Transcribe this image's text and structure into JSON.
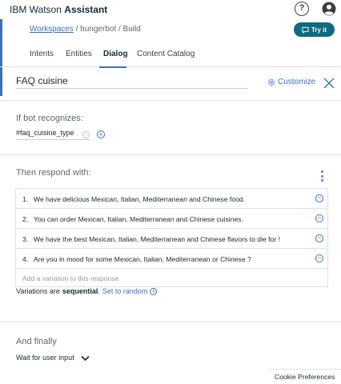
{
  "header": {
    "brand_prefix": "IBM Watson",
    "brand_name": "Assistant",
    "help_glyph": "?"
  },
  "breadcrumb": {
    "workspaces": "Workspaces",
    "path": " / hungerbot / Build"
  },
  "try_button": {
    "label": "Try it"
  },
  "tabs": [
    {
      "label": "Intents",
      "active": false
    },
    {
      "label": "Entities",
      "active": false
    },
    {
      "label": "Dialog",
      "active": true
    },
    {
      "label": "Content Catalog",
      "active": false
    }
  ],
  "node": {
    "title": "FAQ cuisine",
    "customize_label": "Customize"
  },
  "condition": {
    "label": "If bot recognizes:",
    "value": "#faq_cuisine_type"
  },
  "response": {
    "label": "Then respond with:",
    "items": [
      {
        "num": "1.",
        "text": "We have delicious Mexican, Italian, Mediterranean and Chinese food."
      },
      {
        "num": "2.",
        "text": "You can order Mexican, Italian, Mediterranean and Chinese cuisines."
      },
      {
        "num": "3.",
        "text": "We have the best Mexican, Italian, Mediterranean and Chinese flavors to die for !"
      },
      {
        "num": "4.",
        "text": "Are you in mood for some Mexican, Italian, Mediterranean or Chinese ?"
      }
    ],
    "add_placeholder": "Add a variation to this response",
    "variations_prefix": "Variations are",
    "variations_mode": "sequential",
    "variations_suffix": ".",
    "set_random": "Set to random"
  },
  "finally": {
    "label": "And finally",
    "action": "Wait for user input"
  },
  "cookie": {
    "label": "Cookie Preferences"
  },
  "colors": {
    "accent": "#3d70b2",
    "try_button": "#0f6b7e",
    "text": "#152935",
    "muted": "#5a6872"
  }
}
